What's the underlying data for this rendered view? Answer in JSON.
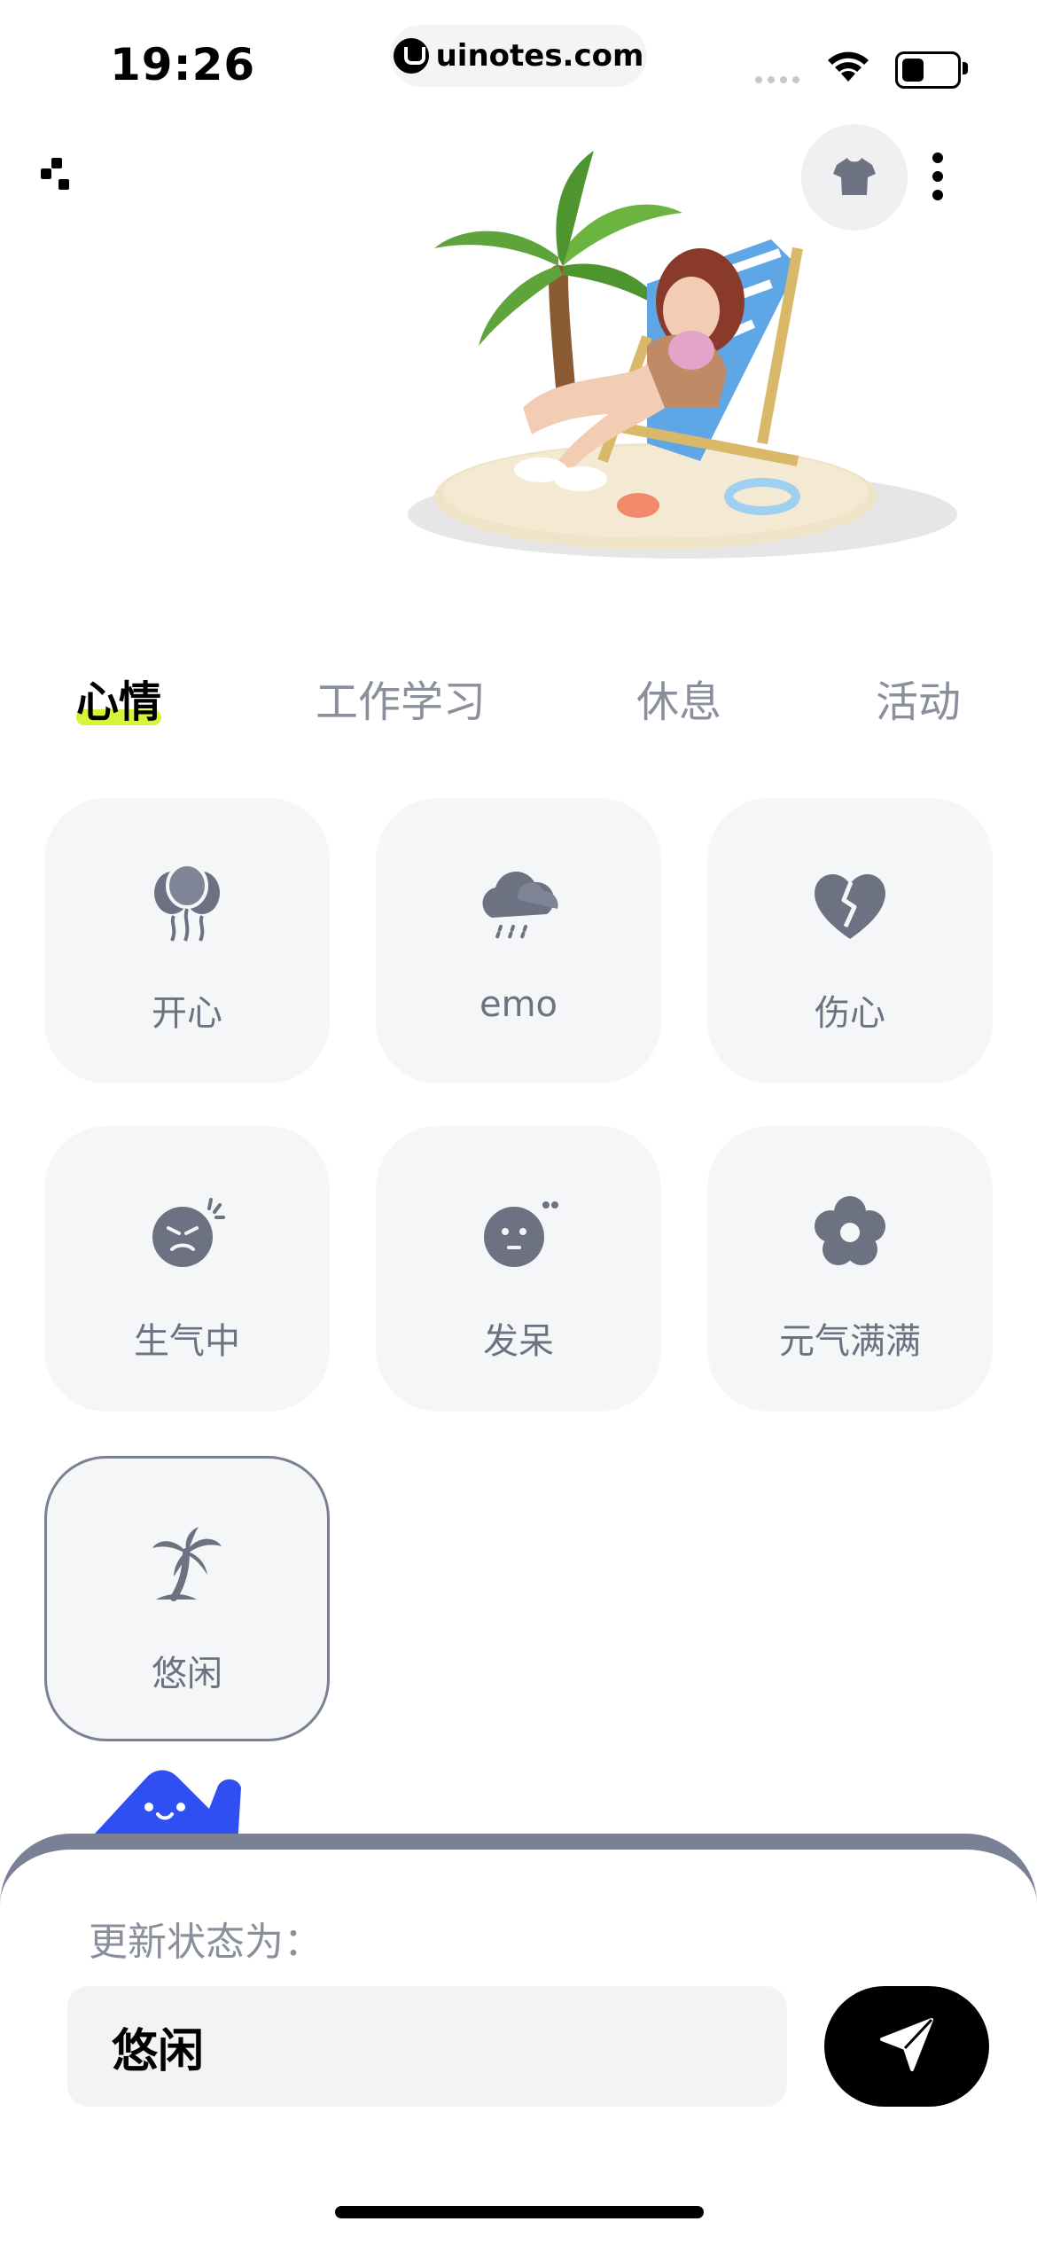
{
  "status_bar": {
    "time": "19:26",
    "url": "uinotes.com"
  },
  "header": {
    "grid_icon": "grid-icon",
    "shirt_icon": "tshirt-icon",
    "more_icon": "more-vertical-icon"
  },
  "tabs": [
    {
      "label": "心情",
      "active": true
    },
    {
      "label": "工作学习",
      "active": false
    },
    {
      "label": "休息",
      "active": false
    },
    {
      "label": "活动",
      "active": false
    }
  ],
  "moods": [
    {
      "label": "开心",
      "icon": "balloons-icon",
      "selected": false
    },
    {
      "label": "emo",
      "icon": "rain-cloud-icon",
      "selected": false
    },
    {
      "label": "伤心",
      "icon": "broken-heart-icon",
      "selected": false
    },
    {
      "label": "生气中",
      "icon": "angry-face-icon",
      "selected": false
    },
    {
      "label": "发呆",
      "icon": "blank-face-icon",
      "selected": false
    },
    {
      "label": "元气满满",
      "icon": "flower-icon",
      "selected": false
    },
    {
      "label": "悠闲",
      "icon": "palm-tree-icon",
      "selected": true
    }
  ],
  "sheet": {
    "label": "更新状态为：",
    "value": "悠闲",
    "send_icon": "send-icon"
  },
  "colors": {
    "accent_underline": "#d4f53a",
    "icon_gray": "#6c7282",
    "mascot_blue": "#2f4ff2"
  }
}
